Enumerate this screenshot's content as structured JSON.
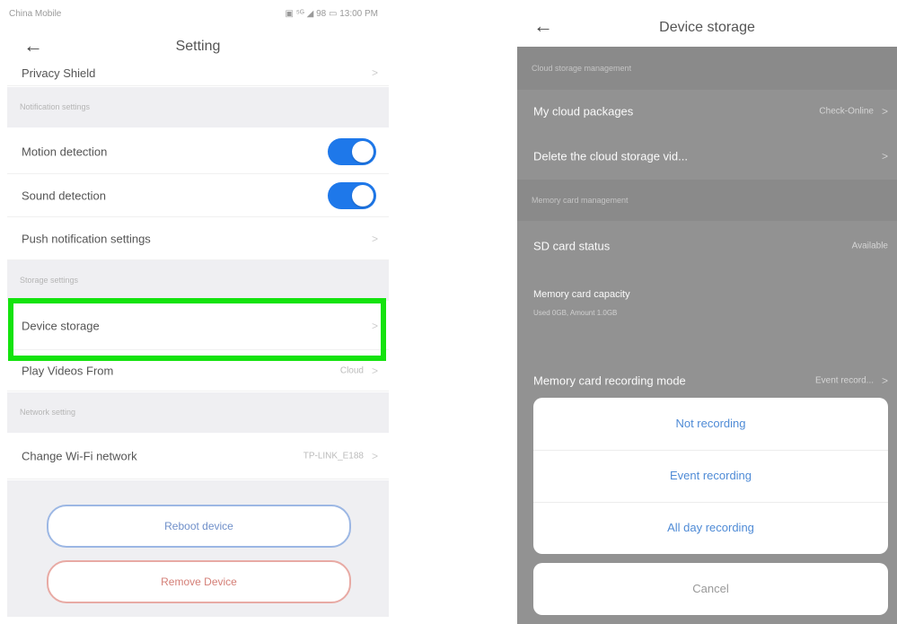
{
  "left": {
    "statusbar": {
      "carrier": "China Mobile",
      "system": "▣ ⁵ᴳ ◢ 98 ▭ 13:00 PM"
    },
    "header": {
      "back": "←",
      "title": "Setting"
    },
    "top_partial_row": {
      "label": "Privacy Shield",
      "chevron": ">"
    },
    "sections": {
      "notification": "Notification settings",
      "storage": "Storage settings",
      "network": "Network setting"
    },
    "rows": {
      "motion": {
        "label": "Motion detection",
        "on": true
      },
      "sound": {
        "label": "Sound detection",
        "on": true
      },
      "push": {
        "label": "Push notification settings",
        "chevron": ">"
      },
      "device_storage": {
        "label": "Device storage",
        "chevron": ">"
      },
      "play_videos": {
        "label": "Play Videos From",
        "value": "Cloud",
        "chevron": ">"
      },
      "wifi": {
        "label": "Change Wi-Fi network",
        "value": "TP-LINK_E188",
        "chevron": ">"
      }
    },
    "buttons": {
      "reboot": "Reboot device",
      "remove": "Remove Device"
    },
    "highlight_color": "#14e30e",
    "toggle_color": "#1e78ea"
  },
  "right": {
    "header": {
      "back": "←",
      "title": "Device storage"
    },
    "sections": {
      "cloud": "Cloud storage management",
      "memory": "Memory card management"
    },
    "rows": {
      "cloud_package": {
        "label": "My cloud packages",
        "value": "Check-Online",
        "chevron": ">"
      },
      "delete_cloud": {
        "label": "Delete the cloud storage vid...",
        "chevron": ">"
      },
      "sd_status": {
        "label": "SD card status",
        "value": "Available"
      },
      "capacity": {
        "label": "Memory card capacity",
        "sub": "Used 0GB, Amount 1.0GB"
      },
      "recording_mode": {
        "label": "Memory card recording mode",
        "value": "Event record...",
        "chevron": ">"
      }
    },
    "sheet": {
      "options": [
        "Not recording",
        "Event recording",
        "All day recording"
      ],
      "cancel": "Cancel"
    },
    "overlay_color": "#929292"
  }
}
